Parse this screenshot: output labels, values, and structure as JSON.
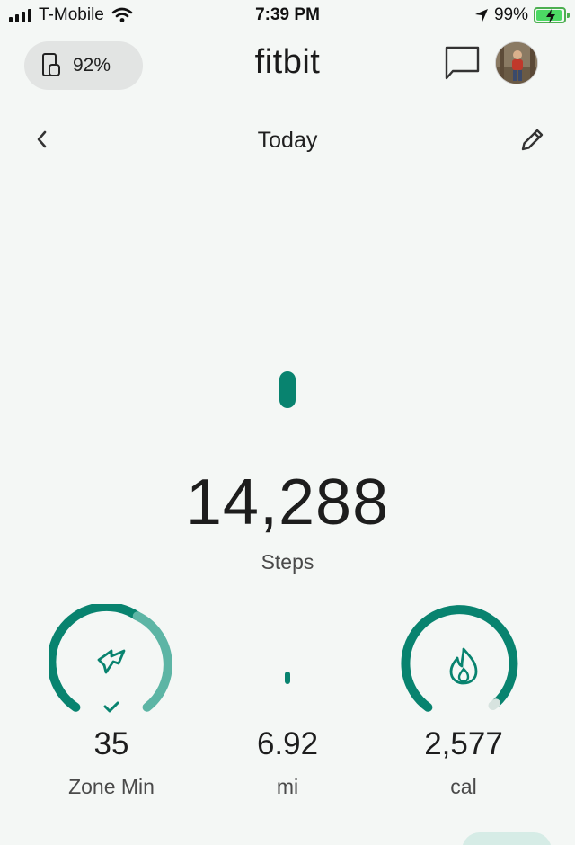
{
  "status_bar": {
    "carrier": "T-Mobile",
    "time": "7:39 PM",
    "battery_percent": "99%",
    "icons": [
      "signal-bars-icon",
      "wifi-icon",
      "location-arrow-icon",
      "battery-charging-icon"
    ]
  },
  "header": {
    "device_battery": "92%",
    "logo": "fitbit",
    "icons": [
      "watch-phone-icon",
      "chat-icon",
      "avatar"
    ]
  },
  "nav": {
    "title": "Today",
    "icons": [
      "back-chevron-icon",
      "edit-pencil-icon"
    ]
  },
  "steps": {
    "value": "14,288",
    "label": "Steps"
  },
  "stats": [
    {
      "id": "zone",
      "value": "35",
      "label": "Zone Min",
      "icon": "zone-minutes-icon",
      "goal_met": true
    },
    {
      "id": "distance",
      "value": "6.92",
      "label": "mi",
      "icon": "distance-indicator"
    },
    {
      "id": "calories",
      "value": "2,577",
      "label": "cal",
      "icon": "flame-icon"
    }
  ],
  "colors": {
    "accent": "#08836f",
    "accent_light": "#5db5a5",
    "background": "#f4f7f5",
    "pill_bg": "#e2e4e3"
  }
}
